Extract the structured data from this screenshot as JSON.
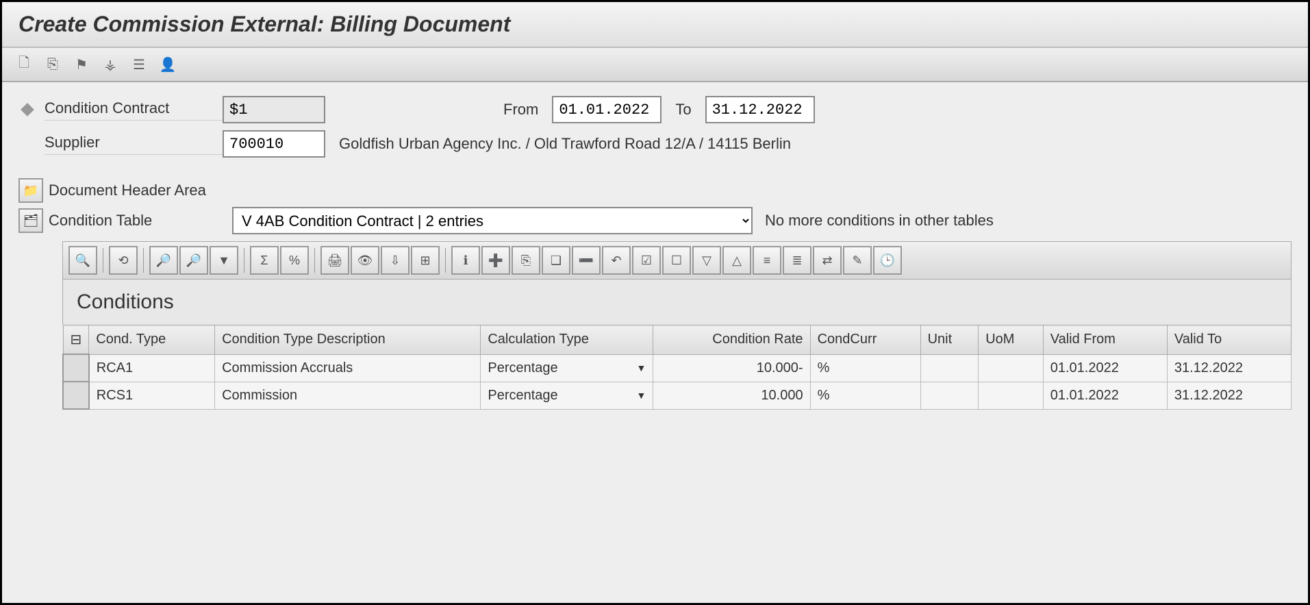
{
  "title": "Create Commission External: Billing Document",
  "header": {
    "contract_label": "Condition Contract",
    "contract_value": "$1",
    "from_label": "From",
    "from_value": "01.01.2022",
    "to_label": "To",
    "to_value": "31.12.2022",
    "supplier_label": "Supplier",
    "supplier_value": "700010",
    "supplier_desc": "Goldfish Urban Agency Inc. / Old Trawford Road 12/A / 14115 Berlin"
  },
  "sections": {
    "doc_header_label": "Document Header Area",
    "cond_table_label": "Condition Table",
    "cond_table_select": "V 4AB Condition Contract  |  2  entries",
    "cond_note": "No more conditions in other tables"
  },
  "grid": {
    "title": "Conditions",
    "columns": {
      "cond_type": "Cond. Type",
      "cond_desc": "Condition Type Description",
      "calc_type": "Calculation Type",
      "cond_rate": "Condition Rate",
      "cond_curr": "CondCurr",
      "unit": "Unit",
      "uom": "UoM",
      "valid_from": "Valid From",
      "valid_to": "Valid To"
    },
    "rows": [
      {
        "cond_type": "RCA1",
        "cond_desc": "Commission Accruals",
        "calc_type": "Percentage",
        "cond_rate": "10.000-",
        "cond_curr": "%",
        "unit": "",
        "uom": "",
        "valid_from": "01.01.2022",
        "valid_to": "31.12.2022"
      },
      {
        "cond_type": "RCS1",
        "cond_desc": "Commission",
        "calc_type": "Percentage",
        "cond_rate": "10.000",
        "cond_curr": "%",
        "unit": "",
        "uom": "",
        "valid_from": "01.01.2022",
        "valid_to": "31.12.2022"
      }
    ]
  },
  "icons": {
    "new": "🗋",
    "other": "⎘",
    "flag": "⚑",
    "hierarchy": "⚶",
    "list": "☰",
    "person": "👤",
    "folder": "📁",
    "tree": "🗂",
    "detail": "🔍",
    "refresh": "⟲",
    "find": "🔎",
    "findnext": "🔎",
    "filter": "▼",
    "sum": "Σ",
    "subtotal": "%",
    "print": "🖨",
    "view": "👁",
    "export": "⇩",
    "layout": "⊞",
    "info": "ℹ",
    "insert": "➕",
    "copy": "⎘",
    "dup": "❏",
    "delete": "➖",
    "undo": "↶",
    "sel_all": "☑",
    "desel": "☐",
    "sort_asc": "▽",
    "sort_desc": "△",
    "col1": "≡",
    "col2": "≣",
    "swap": "⇄",
    "edit": "✎",
    "time": "🕒"
  }
}
